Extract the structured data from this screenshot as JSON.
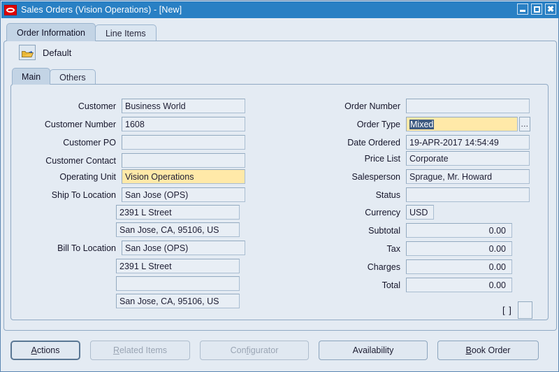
{
  "window": {
    "title": "Sales Orders (Vision Operations) - [New]",
    "logo_icon": "oracle-logo-icon",
    "minimize_label": "",
    "maximize_label": "",
    "close_label": "✖"
  },
  "outer_tabs": [
    {
      "label": "Order Information",
      "active": true
    },
    {
      "label": "Line Items",
      "active": false
    }
  ],
  "toolbar": {
    "folder_icon": "open-folder-icon",
    "default_label": "Default"
  },
  "inner_tabs": [
    {
      "label": "Main",
      "active": true
    },
    {
      "label": "Others",
      "active": false
    }
  ],
  "left_fields": [
    {
      "label": "Customer",
      "value": "Business World"
    },
    {
      "label": "Customer Number",
      "value": "1608"
    },
    {
      "label": "Customer PO",
      "value": ""
    },
    {
      "label": "Customer Contact",
      "value": ""
    },
    {
      "label": "Operating Unit",
      "value": "Vision Operations"
    },
    {
      "label": "Ship To Location",
      "value": "San Jose (OPS)"
    },
    {
      "label": "",
      "value": "2391 L Street"
    },
    {
      "label": "",
      "value": "San Jose, CA, 95106, US"
    },
    {
      "label": "Bill To Location",
      "value": "San Jose (OPS)"
    },
    {
      "label": "",
      "value": "2391 L Street"
    },
    {
      "label": "",
      "value": ""
    },
    {
      "label": "",
      "value": "San Jose, CA, 95106, US"
    }
  ],
  "right_fields": [
    {
      "label": "Order Number",
      "value": ""
    },
    {
      "label": "Order Type",
      "value": "Mixed"
    },
    {
      "label": "Date Ordered",
      "value": "19-APR-2017 14:54:49"
    },
    {
      "label": "Price List",
      "value": "Corporate"
    },
    {
      "label": "Salesperson",
      "value": "Sprague, Mr. Howard"
    },
    {
      "label": "Status",
      "value": ""
    },
    {
      "label": "Currency",
      "value": "USD"
    },
    {
      "label": "Subtotal",
      "value": "0.00"
    },
    {
      "label": "Tax",
      "value": "0.00"
    },
    {
      "label": "Charges",
      "value": "0.00"
    },
    {
      "label": "Total",
      "value": "0.00"
    }
  ],
  "flexfield": {
    "label": "[ ]"
  },
  "buttons": [
    {
      "label": "Actions",
      "accel": "A",
      "disabled": false,
      "focused": true
    },
    {
      "label": "Related Items",
      "accel": "R",
      "disabled": true,
      "focused": false
    },
    {
      "label": "Configurator",
      "accel": "f",
      "disabled": true,
      "focused": false
    },
    {
      "label": "Availability",
      "accel": "",
      "disabled": false,
      "focused": false
    },
    {
      "label": "Book Order",
      "accel": "B",
      "disabled": false,
      "focused": false
    }
  ],
  "colors": {
    "titlebar": "#2980c4",
    "background": "#e4ebf3",
    "required_field": "#ffe9a8",
    "selection": "#3d5a80",
    "oracle_red": "#e00000"
  }
}
